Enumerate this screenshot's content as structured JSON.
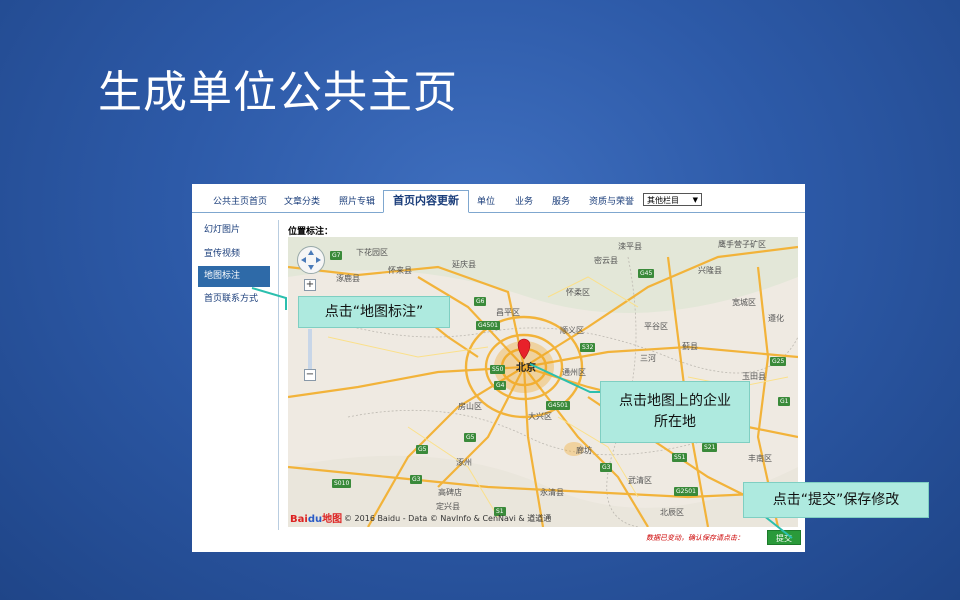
{
  "slide": {
    "title": "生成单位公共主页"
  },
  "tabs": [
    {
      "label": "公共主页首页"
    },
    {
      "label": "文章分类"
    },
    {
      "label": "照片专辑"
    },
    {
      "label": "首页内容更新",
      "active": true
    },
    {
      "label": "单位"
    },
    {
      "label": "业务"
    },
    {
      "label": "服务"
    },
    {
      "label": "资质与荣誉"
    }
  ],
  "tab_select": {
    "value": "其他栏目",
    "arrow": "▼"
  },
  "sidebar": {
    "items": [
      {
        "label": "幻灯图片"
      },
      {
        "label": "宣传视频"
      },
      {
        "label": "地图标注",
        "active": true
      },
      {
        "label": "首页联系方式"
      }
    ]
  },
  "map": {
    "section_label": "位置标注：",
    "city_label": "北京",
    "places": [
      "下花园区",
      "怀来县",
      "涿鹿县",
      "延庆县",
      "昌平区",
      "怀柔区",
      "密云县",
      "兴隆县",
      "宽城区",
      "平谷区",
      "遵化",
      "顺义区",
      "蓟县",
      "三河",
      "通州区",
      "玉田县",
      "丰南区",
      "房山区",
      "大兴区",
      "廊坊",
      "武清区",
      "北辰区",
      "涿州",
      "高碑店",
      "永清县",
      "定兴县",
      "鹰手营子矿区",
      "滦平县"
    ],
    "highways": [
      "G7",
      "G6",
      "G45",
      "G4501",
      "S32",
      "G1",
      "G25",
      "G5",
      "G4",
      "S50",
      "G5",
      "S51",
      "S21",
      "G3",
      "G2501",
      "S010",
      "G3",
      "S1",
      "G4501"
    ],
    "zoom_in": "+",
    "zoom_out": "−",
    "logo_text": "Bai",
    "logo_paw": "du",
    "logo_suffix": "地图",
    "copyright": "© 2016 Baidu - Data © NavInfo & CenNavi & 道道通"
  },
  "footer": {
    "note": "数据已变动，确认保存请点击：",
    "submit_label": "提交"
  },
  "callouts": {
    "sidebar_hint": "点击“地图标注”",
    "map_hint_line1": "点击地图上的企业",
    "map_hint_line2": "所在地",
    "submit_hint": "点击“提交”保存修改"
  },
  "colors": {
    "background": "#2d5aa8",
    "callout": "#aeeadf",
    "active_tab_border": "#7fa7cf",
    "sidebar_active": "#2e6aa8",
    "submit": "#2a9a3a"
  }
}
